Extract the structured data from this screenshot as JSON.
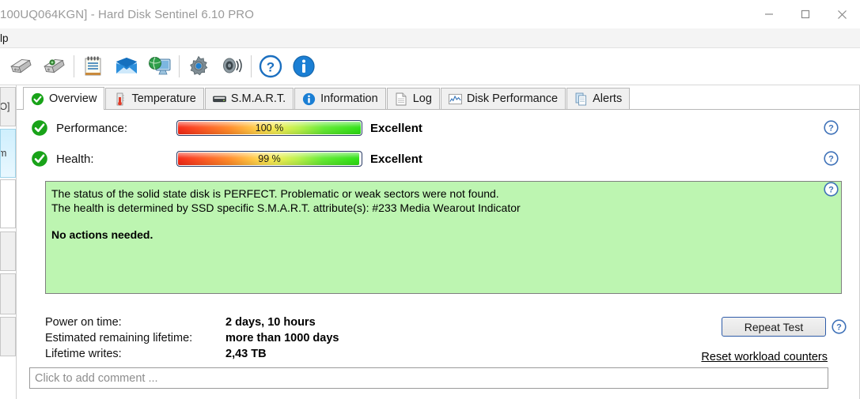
{
  "window": {
    "title": "100UQ064KGN]  -  Hard Disk Sentinel 6.10 PRO",
    "minimize_label": "Minimize",
    "maximize_label": "Maximize",
    "close_label": "Close"
  },
  "menubar": {
    "items": [
      {
        "label": "lp"
      }
    ]
  },
  "toolbar": {
    "buttons": [
      {
        "name": "disk-icon",
        "tooltip": "Disk"
      },
      {
        "name": "disk-settings-icon",
        "tooltip": "Disk settings"
      },
      {
        "name": "notepad-icon",
        "tooltip": "Report"
      },
      {
        "name": "envelope-icon",
        "tooltip": "Send"
      },
      {
        "name": "network-monitor-icon",
        "tooltip": "Network"
      },
      {
        "name": "gear-icon",
        "tooltip": "Configuration"
      },
      {
        "name": "speaker-icon",
        "tooltip": "Sound"
      },
      {
        "name": "help-icon",
        "tooltip": "Help"
      },
      {
        "name": "info-icon",
        "tooltip": "Information"
      }
    ]
  },
  "sidebar": {
    "items": [
      {
        "label": "VO]",
        "state": "normal"
      },
      {
        "label": "em",
        "state": "selected"
      },
      {
        "label": "",
        "state": "plain"
      },
      {
        "label": "",
        "state": "normal"
      },
      {
        "label": "",
        "state": "normal"
      },
      {
        "label": "",
        "state": "normal"
      }
    ]
  },
  "tabs": [
    {
      "label": "Overview",
      "icon": "green-check-icon",
      "active": true
    },
    {
      "label": "Temperature",
      "icon": "thermometer-icon",
      "active": false
    },
    {
      "label": "S.M.A.R.T.",
      "icon": "drive-icon",
      "active": false
    },
    {
      "label": "Information",
      "icon": "info-icon",
      "active": false
    },
    {
      "label": "Log",
      "icon": "document-icon",
      "active": false
    },
    {
      "label": "Disk Performance",
      "icon": "chart-icon",
      "active": false
    },
    {
      "label": "Alerts",
      "icon": "pages-icon",
      "active": false
    }
  ],
  "metrics": [
    {
      "label": "Performance:",
      "value_text": "100 %",
      "percent": 100,
      "verdict": "Excellent",
      "status_icon": "green-check-icon"
    },
    {
      "label": "Health:",
      "value_text": "99 %",
      "percent": 99,
      "verdict": "Excellent",
      "status_icon": "green-check-icon"
    }
  ],
  "status": {
    "line1": "The status of the solid state disk is PERFECT. Problematic or weak sectors were not found.",
    "line2": "The health is determined by SSD specific S.M.A.R.T. attribute(s):  #233 Media Wearout Indicator",
    "action": "No actions needed.",
    "background_color": "#bdf5b1"
  },
  "info": {
    "rows": [
      {
        "key": "Power on time:",
        "value": "2 days, 10 hours"
      },
      {
        "key": "Estimated remaining lifetime:",
        "value": "more than 1000 days"
      },
      {
        "key": "Lifetime writes:",
        "value": "2,43 TB"
      }
    ]
  },
  "actions": {
    "repeat_test_label": "Repeat Test",
    "reset_link_label": "Reset workload counters"
  },
  "comment": {
    "placeholder": "Click to add comment ...",
    "value": ""
  },
  "help_icons": {
    "label": "?",
    "count": 4
  },
  "colors": {
    "accent_blue": "#2f6fb5",
    "status_green": "#bdf5b1",
    "check_green": "#1ea81e",
    "bar_border": "#2b3c66"
  }
}
